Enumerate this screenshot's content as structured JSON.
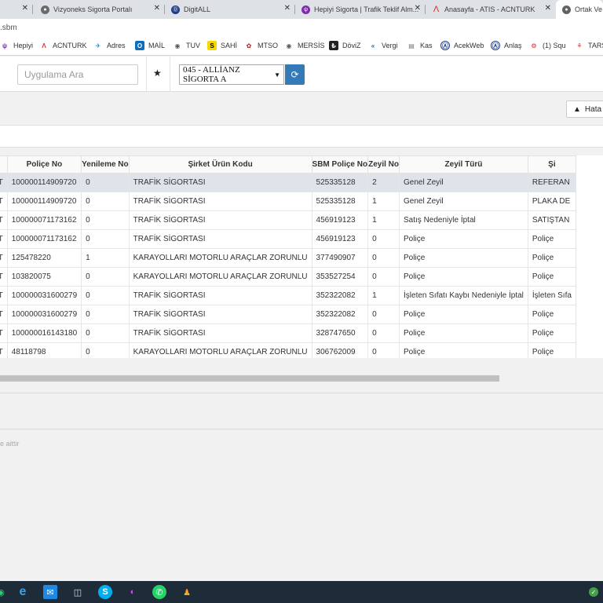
{
  "browser": {
    "tabs": [
      {
        "title": "Vizyoneks Sigorta Portalı",
        "fav_color": "#6b6b6b"
      },
      {
        "title": "DigitALL",
        "fav_color": "#1a3b8c"
      },
      {
        "title": "Hepiyi Sigorta | Trafik Teklif Alm...",
        "fav_color": "#7a2fa0"
      },
      {
        "title": "Anasayfa - ATIS - ACNTURK",
        "fav_color": "#d32f2f"
      },
      {
        "title": "Ortak Ve",
        "fav_color": "#5f6368"
      }
    ],
    "address": ".sbm",
    "bookmarks": [
      "Hepiyi",
      "ACNTURK",
      "Adres",
      "MAİL",
      "TUV",
      "SAHİ",
      "MTSO",
      "MERSİS",
      "DöviZ",
      "Vergi",
      "Kas",
      "AcekWeb",
      "Anlaş",
      "(1) Squ",
      "TARSİ"
    ]
  },
  "toolbar": {
    "search_placeholder": "Uygulama Ara",
    "company_selected": "045 - ALLİANZ SİGORTA A"
  },
  "subheader": {
    "report_button": "Hata"
  },
  "table": {
    "columns": [
      "",
      "Poliçe No",
      "Yenileme No",
      "Şirket Ürün Kodu",
      "SBM Poliçe No",
      "Zeyil No",
      "Zeyil Türü",
      "Şi"
    ],
    "rows": [
      [
        "KURT",
        "100000114909720",
        "0",
        "TRAFİK SİGORTASI",
        "525335128",
        "2",
        "Genel Zeyil",
        "REFERAN"
      ],
      [
        "KURT",
        "100000114909720",
        "0",
        "TRAFİK SİGORTASI",
        "525335128",
        "1",
        "Genel Zeyil",
        "PLAKA DE"
      ],
      [
        "KURT",
        "100000071173162",
        "0",
        "TRAFİK SİGORTASI",
        "456919123",
        "1",
        "Satış Nedeniyle İptal",
        "SATIŞTAN"
      ],
      [
        "KURT",
        "100000071173162",
        "0",
        "TRAFİK SİGORTASI",
        "456919123",
        "0",
        "Poliçe",
        "Poliçe"
      ],
      [
        "AKURT",
        "125478220",
        "1",
        "KARAYOLLARI MOTORLU ARAÇLAR ZORUNLU",
        "377490907",
        "0",
        "Poliçe",
        "Poliçe"
      ],
      [
        "AKURT",
        "103820075",
        "0",
        "KARAYOLLARI MOTORLU ARAÇLAR ZORUNLU",
        "353527254",
        "0",
        "Poliçe",
        "Poliçe"
      ],
      [
        "KURT",
        "100000031600279",
        "0",
        "TRAFİK SİGORTASI",
        "352322082",
        "1",
        "İşleten Sıfatı Kaybı Nedeniyle İptal",
        "İşleten Sıfa"
      ],
      [
        "KURT",
        "100000031600279",
        "0",
        "TRAFİK SİGORTASI",
        "352322082",
        "0",
        "Poliçe",
        "Poliçe"
      ],
      [
        "KURT",
        "100000016143180",
        "0",
        "TRAFİK SİGORTASI",
        "328747650",
        "0",
        "Poliçe",
        "Poliçe"
      ],
      [
        "AKURT",
        "48118798",
        "0",
        "KARAYOLLARI MOTORLU ARAÇLAR ZORUNLU",
        "306762009",
        "0",
        "Poliçe",
        "Poliçe"
      ]
    ]
  },
  "footer": {
    "note": "e aittir"
  }
}
